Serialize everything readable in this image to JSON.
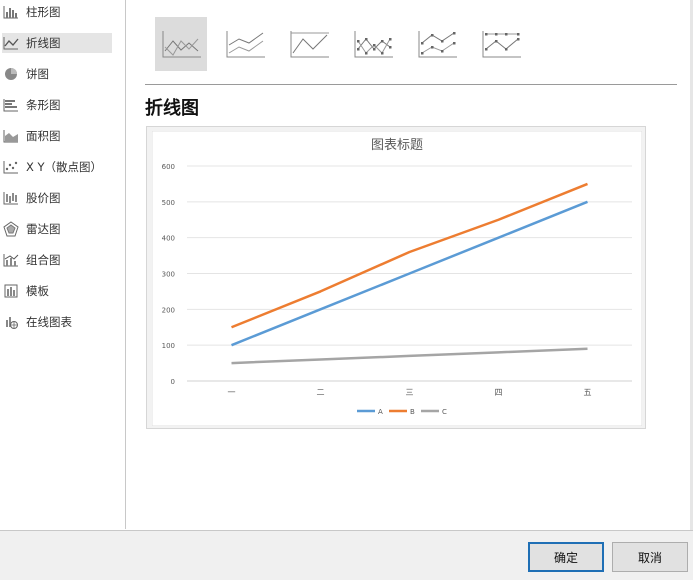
{
  "sidebar": {
    "items": [
      {
        "label": "柱形图",
        "icon": "column-chart-icon"
      },
      {
        "label": "折线图",
        "icon": "line-chart-icon",
        "selected": true
      },
      {
        "label": "饼图",
        "icon": "pie-chart-icon"
      },
      {
        "label": "条形图",
        "icon": "bar-chart-icon"
      },
      {
        "label": "面积图",
        "icon": "area-chart-icon"
      },
      {
        "label": "X Y（散点图）",
        "icon": "scatter-chart-icon"
      },
      {
        "label": "股价图",
        "icon": "stock-chart-icon"
      },
      {
        "label": "雷达图",
        "icon": "radar-chart-icon"
      },
      {
        "label": "组合图",
        "icon": "combo-chart-icon"
      },
      {
        "label": "模板",
        "icon": "template-icon"
      },
      {
        "label": "在线图表",
        "icon": "online-chart-icon"
      }
    ]
  },
  "subtypes": [
    {
      "name": "line",
      "selected": true
    },
    {
      "name": "stacked-line"
    },
    {
      "name": "100-percent-stacked-line"
    },
    {
      "name": "line-with-markers"
    },
    {
      "name": "stacked-line-with-markers"
    },
    {
      "name": "100-percent-stacked-line-with-markers"
    }
  ],
  "main": {
    "type_title": "折线图"
  },
  "colors": {
    "A": "#5b9bd5",
    "B": "#ed7d31",
    "C": "#a5a5a5"
  },
  "chart_data": {
    "type": "line",
    "title": "图表标题",
    "categories": [
      "一",
      "二",
      "三",
      "四",
      "五"
    ],
    "series": [
      {
        "name": "A",
        "values": [
          100,
          200,
          300,
          400,
          500
        ]
      },
      {
        "name": "B",
        "values": [
          150,
          250,
          360,
          450,
          550
        ]
      },
      {
        "name": "C",
        "values": [
          50,
          60,
          70,
          80,
          90
        ]
      }
    ],
    "ylim": [
      0,
      600
    ],
    "yticks": [
      0,
      100,
      200,
      300,
      400,
      500,
      600
    ],
    "grid": true,
    "legend": "bottom"
  },
  "footer": {
    "ok_label": "确定",
    "cancel_label": "取消"
  }
}
